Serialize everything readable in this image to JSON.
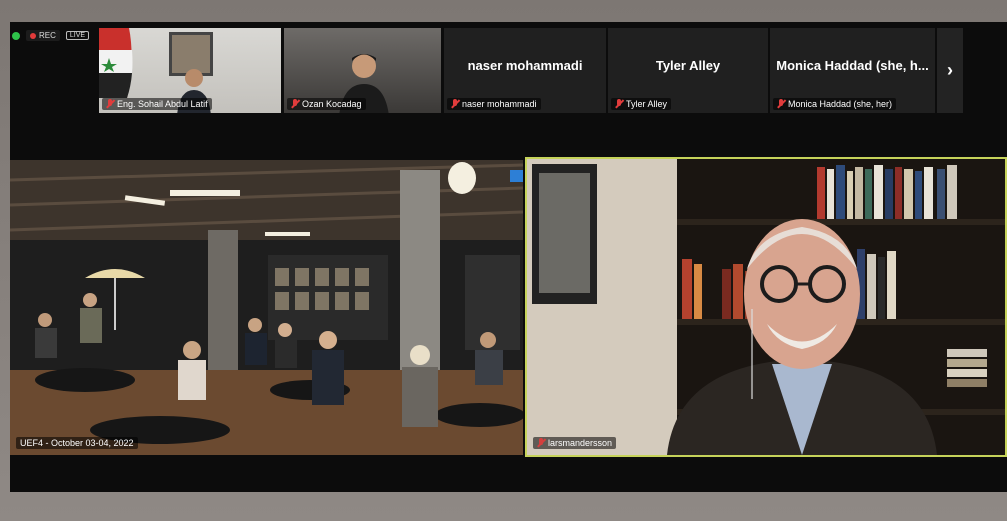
{
  "status": {
    "rec_label": "REC",
    "live_label": "LIVE"
  },
  "thumbnails": [
    {
      "name": "Eng. Sohail Abdul Latif"
    },
    {
      "name": "Ozan Kocadag"
    },
    {
      "display_name": "naser mohammadi",
      "name": "naser mohammadi"
    },
    {
      "display_name": "Tyler Alley",
      "name": "Tyler Alley"
    },
    {
      "display_name": "Monica Haddad (she, h...",
      "name": "Monica Haddad (she, her)"
    }
  ],
  "next_arrow": "›",
  "main": {
    "left_label": "UEF4 - October 03-04, 2022",
    "right_label": "larsmandersson"
  },
  "colors": {
    "active_speaker_border": "#c6d35a",
    "mic_muted": "#e13c3c",
    "status_ok": "#2ec24a"
  }
}
